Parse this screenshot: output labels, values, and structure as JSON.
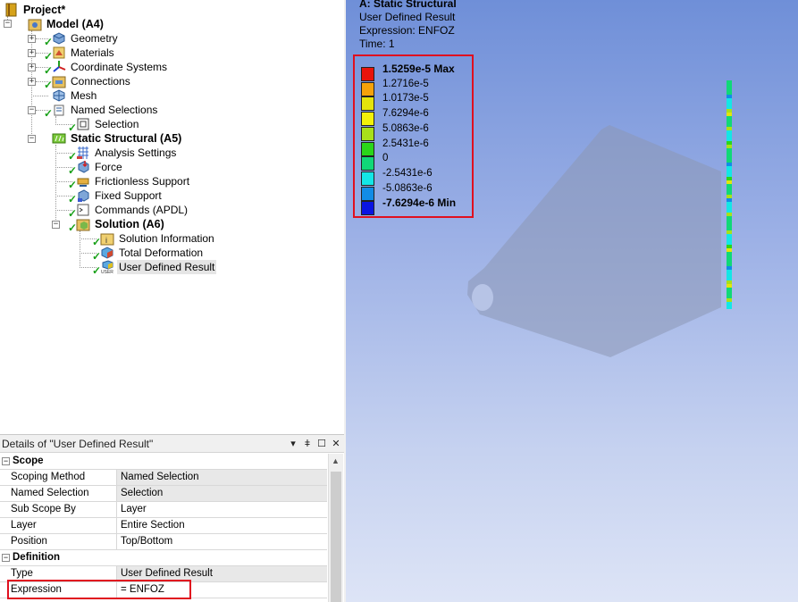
{
  "tree": {
    "project": "Project*",
    "model": "Model (A4)",
    "geometry": "Geometry",
    "materials": "Materials",
    "coordinate_systems": "Coordinate Systems",
    "connections": "Connections",
    "mesh": "Mesh",
    "named_selections": "Named Selections",
    "selection": "Selection",
    "static_structural": "Static Structural (A5)",
    "analysis_settings": "Analysis Settings",
    "force": "Force",
    "frictionless_support": "Frictionless Support",
    "fixed_support": "Fixed Support",
    "commands": "Commands (APDL)",
    "solution": "Solution (A6)",
    "solution_information": "Solution Information",
    "total_deformation": "Total Deformation",
    "user_defined_result": "User Defined Result"
  },
  "details": {
    "title": "Details of \"User Defined Result\"",
    "buttons": {
      "dropdown": "▾",
      "pin": "ǂ",
      "maximize": "☐",
      "close": "✕"
    },
    "scope_header": "Scope",
    "scope_rows": [
      {
        "label": "Scoping Method",
        "value": "Named Selection"
      },
      {
        "label": "Named Selection",
        "value": "Selection"
      },
      {
        "label": "Sub Scope By",
        "value": "Layer"
      },
      {
        "label": "Layer",
        "value": "Entire Section"
      },
      {
        "label": "Position",
        "value": "Top/Bottom"
      }
    ],
    "definition_header": "Definition",
    "definition_rows": [
      {
        "label": "Type",
        "value": "User Defined Result"
      },
      {
        "label": "Expression",
        "value": "= ENFOZ"
      }
    ]
  },
  "viewport": {
    "title": "A: Static Structural",
    "result_name": "User Defined Result",
    "expression": "Expression: ENFOZ",
    "time": "Time: 1",
    "legend": [
      {
        "label": "1.5259e-5 Max",
        "color": "#e8140c",
        "bold": true
      },
      {
        "label": "1.2716e-5",
        "color": "#f5a20a"
      },
      {
        "label": "1.0173e-5",
        "color": "#e4e40c"
      },
      {
        "label": "7.6294e-6",
        "color": "#f2f20a"
      },
      {
        "label": "5.0863e-6",
        "color": "#a8e01a"
      },
      {
        "label": "2.5431e-6",
        "color": "#2ad61a"
      },
      {
        "label": "0",
        "color": "#10d878"
      },
      {
        "label": "-2.5431e-6",
        "color": "#14e6e6"
      },
      {
        "label": "-5.0863e-6",
        "color": "#128ce6"
      },
      {
        "label": "-7.6294e-6 Min",
        "color": "#0a14e2",
        "bold": true
      }
    ]
  },
  "colors": {
    "highlight": "#e0101f",
    "checkmark": "#18a018",
    "part_fill": "#8c98b4"
  }
}
